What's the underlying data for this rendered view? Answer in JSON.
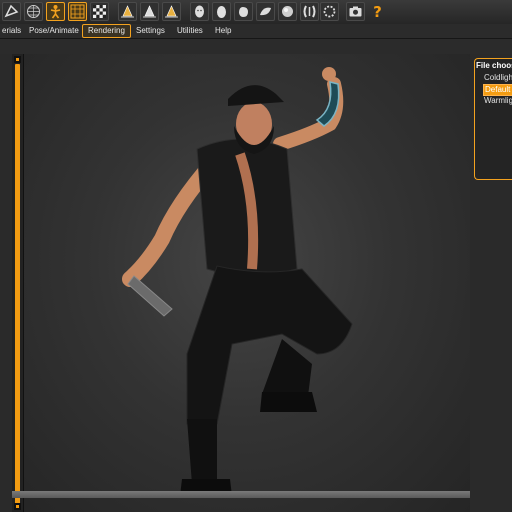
{
  "toolbar": {
    "buttons": [
      {
        "icon": "lasso-select-icon",
        "active": false
      },
      {
        "icon": "mesh-sphere-icon",
        "active": false
      },
      {
        "icon": "figure-pose-icon",
        "active": true
      },
      {
        "icon": "grid-icon",
        "active": true
      },
      {
        "icon": "checkerboard-icon",
        "active": false
      },
      {
        "icon": "move-arrow-icon",
        "active": false
      },
      {
        "icon": "rotate-arrow-icon",
        "active": false
      },
      {
        "icon": "scale-arrow-icon",
        "active": false
      },
      {
        "icon": "head-icon",
        "active": false
      },
      {
        "icon": "egg-icon",
        "active": false
      },
      {
        "icon": "hand-icon",
        "active": false
      },
      {
        "icon": "foot-icon",
        "active": false
      },
      {
        "icon": "sphere-icon",
        "active": false
      },
      {
        "icon": "bulge-icon",
        "active": false
      },
      {
        "icon": "ring-icon",
        "active": false
      },
      {
        "icon": "camera-icon",
        "active": false
      },
      {
        "icon": "help-icon",
        "active": false
      }
    ],
    "help_glyph": "?"
  },
  "tabs": [
    {
      "label": "erials",
      "active": false
    },
    {
      "label": "Pose/Animate",
      "active": false
    },
    {
      "label": "Rendering",
      "active": true
    },
    {
      "label": "Settings",
      "active": false
    },
    {
      "label": "Utilities",
      "active": false
    },
    {
      "label": "Help",
      "active": false
    }
  ],
  "file_chooser": {
    "title": "File choos",
    "items": [
      {
        "label": "Coldligh",
        "selected": false
      },
      {
        "label": "Default",
        "selected": true
      },
      {
        "label": "Warmlig",
        "selected": false
      }
    ]
  },
  "colors": {
    "accent": "#f39c12",
    "background": "#2a2a2a",
    "viewport": "#3a3a3a"
  }
}
